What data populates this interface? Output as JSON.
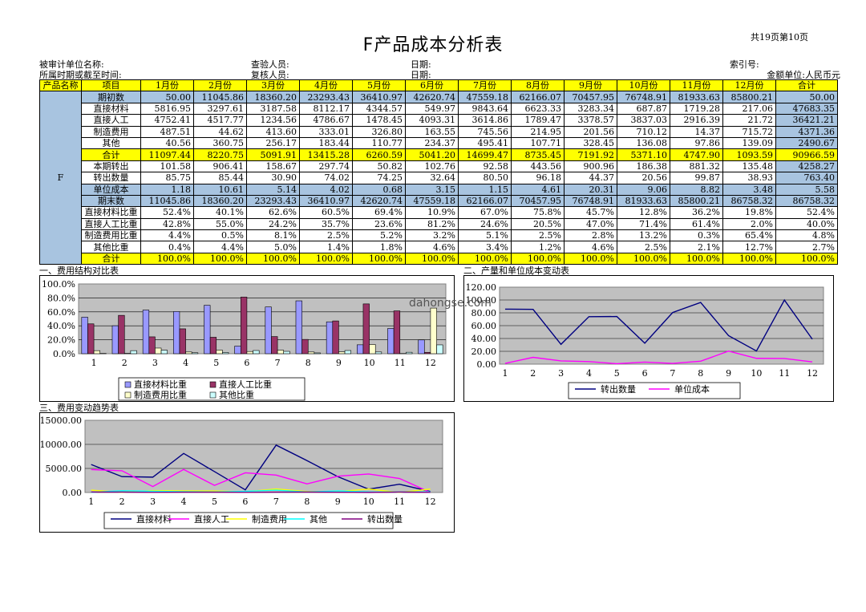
{
  "header": {
    "title": "F产品成本分析表",
    "page_info": "共19页第10页",
    "audited_unit": "被审计单位名称:",
    "checker": "查验人员:",
    "date1": "日期:",
    "index_no": "索引号:",
    "period": "所属时期或截至时间:",
    "reviewer": "复核人员:",
    "date2": "日期:",
    "currency": "金额单位:人民币元"
  },
  "table": {
    "col_headers": [
      "产品名称",
      "项目",
      "1月份",
      "2月份",
      "3月份",
      "4月份",
      "5月份",
      "6月份",
      "7月份",
      "8月份",
      "9月份",
      "10月份",
      "11月份",
      "12月份",
      "合计"
    ],
    "product": "F",
    "rows": [
      {
        "label": "期初数",
        "values": [
          "50.00",
          "11045.86",
          "18360.20",
          "23293.43",
          "36410.97",
          "42620.74",
          "47559.18",
          "62166.07",
          "70457.95",
          "76748.91",
          "81933.63",
          "85800.21",
          "50.00"
        ]
      },
      {
        "label": "直接材料",
        "values": [
          "5816.95",
          "3297.61",
          "3187.58",
          "8112.17",
          "4344.57",
          "549.97",
          "9843.64",
          "6623.33",
          "3283.34",
          "687.87",
          "1719.28",
          "217.06",
          "47683.35"
        ]
      },
      {
        "label": "直接人工",
        "values": [
          "4752.41",
          "4517.77",
          "1234.56",
          "4786.67",
          "1478.45",
          "4093.31",
          "3614.86",
          "1789.47",
          "3378.57",
          "3837.03",
          "2916.39",
          "21.72",
          "36421.21"
        ]
      },
      {
        "label": "制造费用",
        "values": [
          "487.51",
          "44.62",
          "413.60",
          "333.01",
          "326.80",
          "163.55",
          "745.56",
          "214.95",
          "201.56",
          "710.12",
          "14.37",
          "715.72",
          "4371.36"
        ]
      },
      {
        "label": "其他",
        "values": [
          "40.56",
          "360.75",
          "256.17",
          "183.44",
          "110.77",
          "234.37",
          "495.41",
          "107.71",
          "328.45",
          "136.08",
          "97.86",
          "139.09",
          "2490.67"
        ]
      },
      {
        "label": "合计",
        "values": [
          "11097.44",
          "8220.75",
          "5091.91",
          "13415.28",
          "6260.59",
          "5041.20",
          "14699.47",
          "8735.45",
          "7191.92",
          "5371.10",
          "4747.90",
          "1093.59",
          "90966.59"
        ]
      },
      {
        "label": "本期转出",
        "values": [
          "101.58",
          "906.41",
          "158.67",
          "297.74",
          "50.82",
          "102.76",
          "92.58",
          "443.56",
          "900.96",
          "186.38",
          "881.32",
          "135.48",
          "4258.27"
        ]
      },
      {
        "label": "转出数量",
        "values": [
          "85.75",
          "85.44",
          "30.90",
          "74.02",
          "74.25",
          "32.64",
          "80.50",
          "96.18",
          "44.37",
          "20.56",
          "99.87",
          "38.93",
          "763.40"
        ]
      },
      {
        "label": "单位成本",
        "values": [
          "1.18",
          "10.61",
          "5.14",
          "4.02",
          "0.68",
          "3.15",
          "1.15",
          "4.61",
          "20.31",
          "9.06",
          "8.82",
          "3.48",
          "5.58"
        ]
      },
      {
        "label": "期末数",
        "values": [
          "11045.86",
          "18360.20",
          "23293.43",
          "36410.97",
          "42620.74",
          "47559.18",
          "62166.07",
          "70457.95",
          "76748.91",
          "81933.63",
          "85800.21",
          "86758.32",
          "86758.32"
        ]
      },
      {
        "label": "直接材料比重",
        "values": [
          "52.4%",
          "40.1%",
          "62.6%",
          "60.5%",
          "69.4%",
          "10.9%",
          "67.0%",
          "75.8%",
          "45.7%",
          "12.8%",
          "36.2%",
          "19.8%",
          "52.4%"
        ]
      },
      {
        "label": "直接人工比重",
        "values": [
          "42.8%",
          "55.0%",
          "24.2%",
          "35.7%",
          "23.6%",
          "81.2%",
          "24.6%",
          "20.5%",
          "47.0%",
          "71.4%",
          "61.4%",
          "2.0%",
          "40.0%"
        ]
      },
      {
        "label": "制造费用比重",
        "values": [
          "4.4%",
          "0.5%",
          "8.1%",
          "2.5%",
          "5.2%",
          "3.2%",
          "5.1%",
          "2.5%",
          "2.8%",
          "13.2%",
          "0.3%",
          "65.4%",
          "4.8%"
        ]
      },
      {
        "label": "其他比重",
        "values": [
          "0.4%",
          "4.4%",
          "5.0%",
          "1.4%",
          "1.8%",
          "4.6%",
          "3.4%",
          "1.2%",
          "4.6%",
          "2.5%",
          "2.1%",
          "12.7%",
          "2.7%"
        ]
      },
      {
        "label": "合计",
        "values": [
          "100.0%",
          "100.0%",
          "100.0%",
          "100.0%",
          "100.0%",
          "100.0%",
          "100.0%",
          "100.0%",
          "100.0%",
          "100.0%",
          "100.0%",
          "100.0%",
          "100.0%"
        ]
      }
    ]
  },
  "sections": {
    "s1": "一、费用结构对比表",
    "s2": "二、产量和单位成本变动表",
    "s3": "三、费用变动趋势表"
  },
  "watermark": "dahongse.com",
  "chart_data": [
    {
      "type": "bar",
      "title": "一、费用结构对比表",
      "categories": [
        "1",
        "2",
        "3",
        "4",
        "5",
        "6",
        "7",
        "8",
        "9",
        "10",
        "11",
        "12"
      ],
      "ylim": [
        0,
        100
      ],
      "y_ticks": [
        "0.0%",
        "20.0%",
        "40.0%",
        "60.0%",
        "80.0%",
        "100.0%"
      ],
      "series": [
        {
          "name": "直接材料比重",
          "color": "#9999ff",
          "values": [
            52.4,
            40.1,
            62.6,
            60.5,
            69.4,
            10.9,
            67.0,
            75.8,
            45.7,
            12.8,
            36.2,
            19.8
          ]
        },
        {
          "name": "直接人工比重",
          "color": "#993366",
          "values": [
            42.8,
            55.0,
            24.2,
            35.7,
            23.6,
            81.2,
            24.6,
            20.5,
            47.0,
            71.4,
            61.4,
            2.0
          ]
        },
        {
          "name": "制造费用比重",
          "color": "#ffffcc",
          "values": [
            4.4,
            0.5,
            8.1,
            2.5,
            5.2,
            3.2,
            5.1,
            2.5,
            2.8,
            13.2,
            0.3,
            65.4
          ]
        },
        {
          "name": "其他比重",
          "color": "#ccffff",
          "values": [
            0.4,
            4.4,
            5.0,
            1.4,
            1.8,
            4.6,
            3.4,
            1.2,
            4.6,
            2.5,
            2.1,
            12.7
          ]
        }
      ],
      "legend": "bottom"
    },
    {
      "type": "line",
      "title": "二、产量和单位成本变动表",
      "x": [
        "1",
        "2",
        "3",
        "4",
        "5",
        "6",
        "7",
        "8",
        "9",
        "10",
        "11",
        "12"
      ],
      "ylim": [
        0,
        120
      ],
      "y_ticks": [
        "0.00",
        "20.00",
        "40.00",
        "60.00",
        "80.00",
        "100.00",
        "120.00"
      ],
      "series": [
        {
          "name": "转出数量",
          "color": "#000080",
          "values": [
            85.75,
            85.44,
            30.9,
            74.02,
            74.25,
            32.64,
            80.5,
            96.18,
            44.37,
            20.56,
            99.87,
            38.93
          ]
        },
        {
          "name": "单位成本",
          "color": "#ff00ff",
          "values": [
            1.18,
            10.61,
            5.14,
            4.02,
            0.68,
            3.15,
            1.15,
            4.61,
            20.31,
            9.06,
            8.82,
            3.48
          ]
        }
      ],
      "legend": "bottom"
    },
    {
      "type": "line",
      "title": "三、费用变动趋势表",
      "x": [
        "1",
        "2",
        "3",
        "4",
        "5",
        "6",
        "7",
        "8",
        "9",
        "10",
        "11",
        "12"
      ],
      "ylim": [
        0,
        15000
      ],
      "y_ticks": [
        "0.00",
        "5000.00",
        "10000.00",
        "15000.00"
      ],
      "series": [
        {
          "name": "直接材料",
          "color": "#000080",
          "values": [
            5816.95,
            3297.61,
            3187.58,
            8112.17,
            4344.57,
            549.97,
            9843.64,
            6623.33,
            3283.34,
            687.87,
            1719.28,
            217.06
          ]
        },
        {
          "name": "直接人工",
          "color": "#ff00ff",
          "values": [
            4752.41,
            4517.77,
            1234.56,
            4786.67,
            1478.45,
            4093.31,
            3614.86,
            1789.47,
            3378.57,
            3837.03,
            2916.39,
            21.72
          ]
        },
        {
          "name": "制造费用",
          "color": "#ffff00",
          "values": [
            487.51,
            44.62,
            413.6,
            333.01,
            326.8,
            163.55,
            745.56,
            214.95,
            201.56,
            710.12,
            14.37,
            715.72
          ]
        },
        {
          "name": "其他",
          "color": "#00ffff",
          "values": [
            40.56,
            360.75,
            256.17,
            183.44,
            110.77,
            234.37,
            495.41,
            107.71,
            328.45,
            136.08,
            97.86,
            139.09
          ]
        },
        {
          "name": "转出数量",
          "color": "#800080",
          "values": [
            85.75,
            85.44,
            30.9,
            74.02,
            74.25,
            32.64,
            80.5,
            96.18,
            44.37,
            20.56,
            99.87,
            38.93
          ]
        }
      ],
      "legend": "bottom"
    }
  ]
}
